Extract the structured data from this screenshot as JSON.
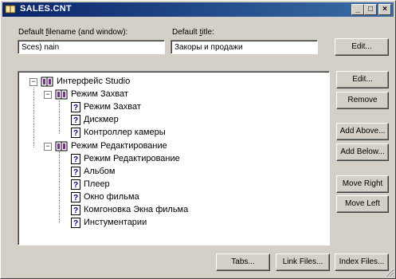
{
  "window": {
    "title": "SALES.CNT",
    "controls": {
      "minimize": "_",
      "maximize": "□",
      "close": "×"
    }
  },
  "fields": {
    "filename_label_pre": "Default ",
    "filename_label_acc": "f",
    "filename_label_post": "ilename (and window):",
    "filename_value": "Sces) nain",
    "title_label_pre": "Default ",
    "title_label_acc": "t",
    "title_label_post": "itle:",
    "title_value": "Закоры и продажи"
  },
  "buttons": {
    "edit_top": "Edit...",
    "edit": "Edit...",
    "remove": "Remove",
    "add_above": "Add Above...",
    "add_below": "Add Below...",
    "move_right": "Move Right",
    "move_left": "Move Left",
    "tabs": "Tabs...",
    "link_files": "Link Files...",
    "index_files": "Index Files..."
  },
  "tree": {
    "root": "Интерфейс Studio",
    "group1": "Режим Захват",
    "group1_items": [
      "Режим Захват",
      "Дискмер",
      "Контроллер камеры"
    ],
    "group2": "Режим Редактирование",
    "group2_items": [
      "Режим Редактирование",
      "Альбом",
      "Плеер",
      "Окно фильма",
      "Комгоновка Экна фильма",
      "Инстументарии"
    ]
  },
  "colors": {
    "title_bar_start": "#0a246a",
    "title_bar_end": "#3a6ea5",
    "face": "#d4d0c8"
  },
  "icons": [
    "book-icon",
    "help-topic-icon",
    "expand-toggle-icon"
  ]
}
